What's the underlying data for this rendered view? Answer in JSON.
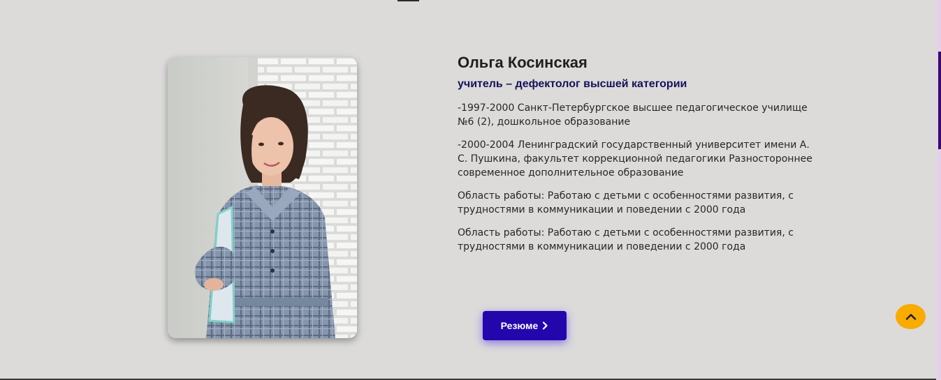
{
  "profile": {
    "name": "Ольга Косинская",
    "role": "учитель – дефектолог высшей категории",
    "photo_alt": "Ольга Косинская",
    "paragraphs": [
      "-1997-2000 Санкт-Петербургское высшее педагогическое училище №6 (2), дошкольное образование",
      "-2000-2004 Ленинградский государственный университет имени А. С. Пушкина, факультет коррекционной педагогики Разностороннее современное дополнительное образование",
      "Область работы: Работаю с детьми с особенностями развития, с трудностями в коммуникации и поведении с 2000 года",
      "Область работы: Работаю с детьми с особенностями развития, с трудностями в коммуникации и поведении с 2000 года"
    ]
  },
  "actions": {
    "resume_label": "Резюме",
    "resume_icon": "chevron-right-icon",
    "scroll_top_icon": "chevron-up-icon"
  },
  "colors": {
    "background": "#dcdbda",
    "button": "#2406ad",
    "role_text": "#14125a",
    "scroll_top": "#f9ab00",
    "scrollbar_thumb": "#3b0a6e"
  }
}
